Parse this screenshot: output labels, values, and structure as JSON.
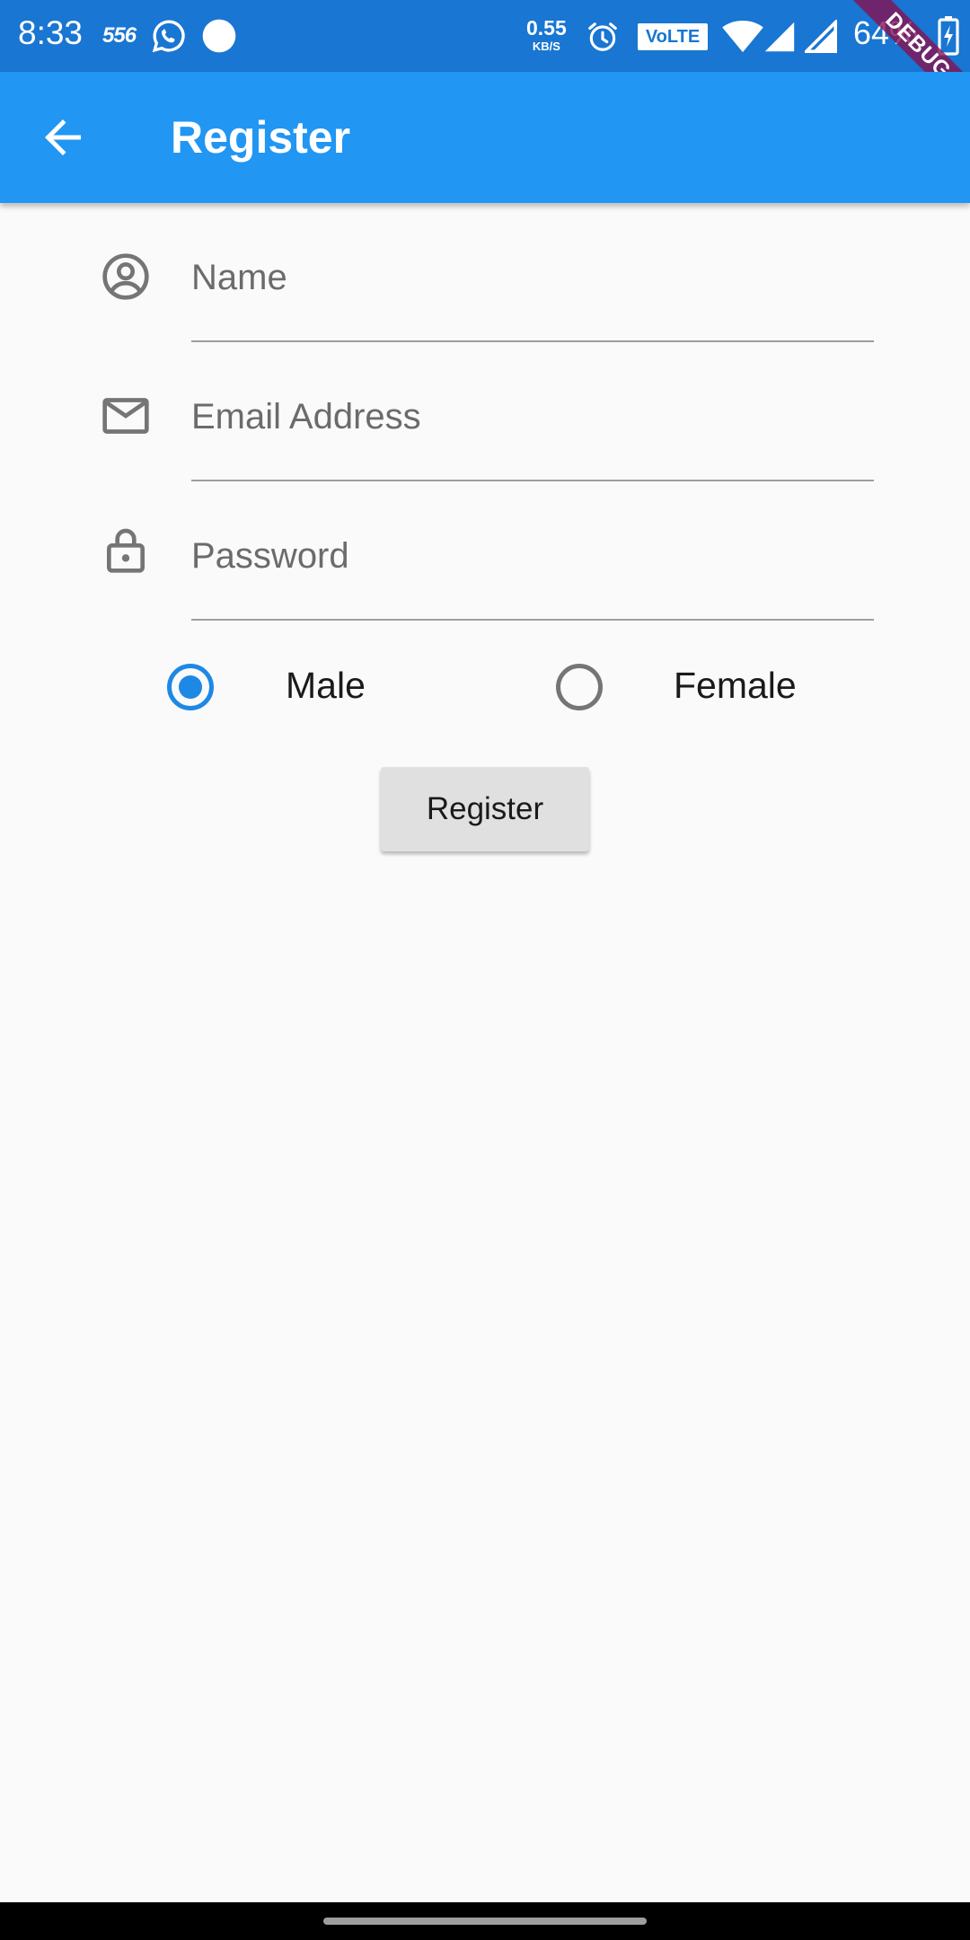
{
  "status_bar": {
    "time": "8:33",
    "carrier_badge": "556",
    "net_speed_value": "0.55",
    "net_speed_unit": "KB/S",
    "volte": "VoLTE",
    "battery": "64%",
    "debug_banner": "DEBUG",
    "icons": [
      "whatsapp-icon",
      "notification-dot-icon",
      "alarm-icon",
      "wifi-icon",
      "signal-icon",
      "signal-icon",
      "battery-charging-icon"
    ]
  },
  "app_bar": {
    "title": "Register",
    "back_icon": "arrow-back-icon"
  },
  "form": {
    "name": {
      "placeholder": "Name",
      "value": "",
      "icon": "account-circle-icon"
    },
    "email": {
      "placeholder": "Email Address",
      "value": "",
      "icon": "mail-icon"
    },
    "password": {
      "placeholder": "Password",
      "value": "",
      "icon": "lock-icon"
    },
    "gender": {
      "selected": "Male",
      "options": [
        "Male",
        "Female"
      ]
    },
    "submit_label": "Register"
  },
  "colors": {
    "status_bar": "#1976d2",
    "app_bar": "#2196f3",
    "accent": "#1e88e5",
    "background": "#fafafa",
    "button": "#e0e0e0"
  }
}
